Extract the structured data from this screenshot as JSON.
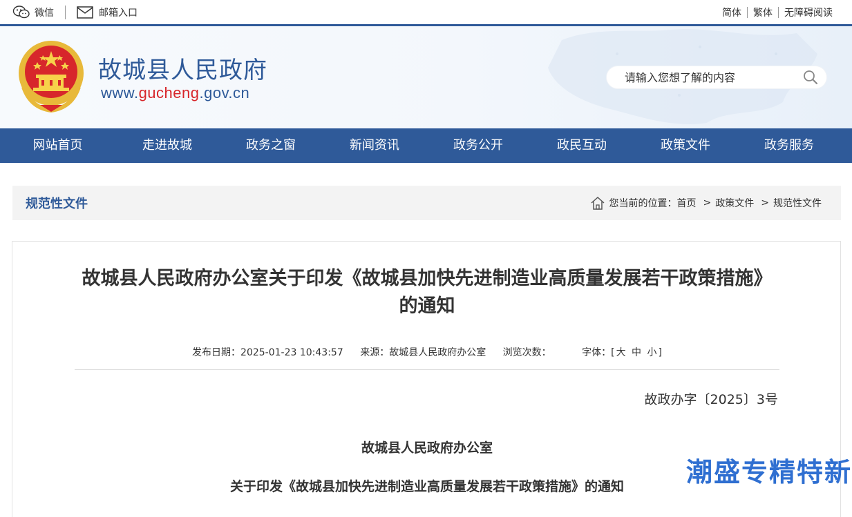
{
  "topbar": {
    "wechat": "微信",
    "mailbox": "邮箱入口",
    "simplified": "简体",
    "traditional": "繁体",
    "accessible": "无障碍阅读"
  },
  "header": {
    "site_name": "故城县人民政府",
    "url_prefix": "www.",
    "url_mid": "gucheng",
    "url_suffix": ".gov.cn",
    "search_placeholder": "请输入您想了解的内容"
  },
  "nav": {
    "items": [
      "网站首页",
      "走进故城",
      "政务之窗",
      "新闻资讯",
      "政务公开",
      "政民互动",
      "政策文件",
      "政务服务"
    ]
  },
  "breadcrumb": {
    "section_title": "规范性文件",
    "location_label": "您当前的位置：",
    "items": [
      "首页",
      "政策文件",
      "规范性文件"
    ],
    "arrow": ">"
  },
  "article": {
    "title": "故城县人民政府办公室关于印发《故城县加快先进制造业高质量发展若干政策措施》的通知",
    "publish_date": "发布日期：2025-01-23  10:43:57",
    "source": "来源：故城县人民政府办公室",
    "views": "浏览次数：",
    "font_size_label": "字体：[",
    "font_large": "大",
    "font_medium": "中",
    "font_small": "小",
    "font_size_end": "]",
    "doc_number": "故政办字〔2025〕3号",
    "issuer": "故城县人民政府办公室",
    "subtitle": "关于印发《故城县加快先进制造业高质量发展若干政策措施》的通知"
  },
  "watermark": "潮盛专精特新",
  "colors": {
    "primary": "#2f5a99",
    "accent_red": "#d7262b",
    "watermark": "#2f6fd1"
  }
}
